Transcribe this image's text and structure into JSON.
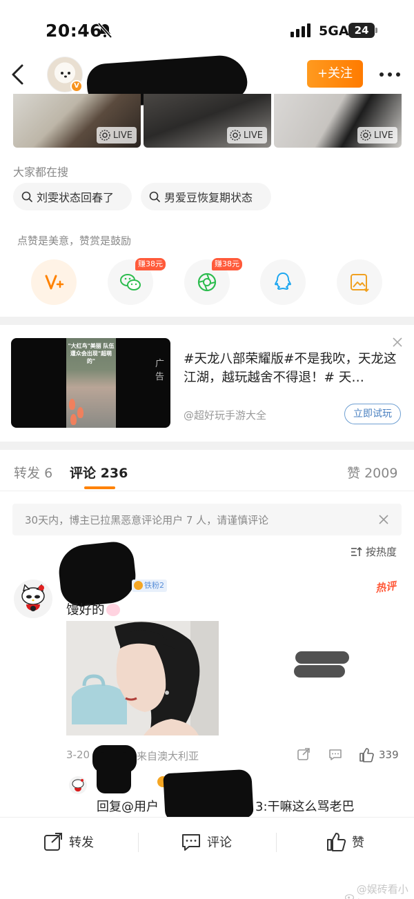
{
  "status_bar": {
    "time": "20:46",
    "network": "5GA",
    "battery": "24"
  },
  "nav": {
    "follow_label": "+关注"
  },
  "photos": {
    "live_label": "LIVE"
  },
  "search": {
    "heading": "大家都在搜",
    "chips": [
      "刘雯状态回春了",
      "男爱豆恢复期状态"
    ]
  },
  "reward": {
    "tip": "点赞是美意，赞赏是鼓励",
    "earn_badge": "赚38元"
  },
  "ad": {
    "label": "广告",
    "title": "#天龙八部荣耀版#不是我吹，天龙这江湖，越玩越舍不得退！# 天…",
    "account": "@超好玩手游大全",
    "cta": "立即试玩",
    "thumb_caption": "\"大红鸟\"美丽 队伍遭众会出现\"超萌的\""
  },
  "tabs": {
    "repost_label": "转发",
    "repost_count": "6",
    "comment_label": "评论",
    "comment_count": "236",
    "like_label": "赞",
    "like_count": "2009"
  },
  "notice": {
    "text": "30天内，博主已拉黑恶意评论用户 7 人，请谨慎评论"
  },
  "sort": {
    "label": "按热度"
  },
  "comment": {
    "fan_badge": "铁粉2",
    "hot_label": "热评",
    "text": "馒好的",
    "date": "3-20",
    "location": "来自澳大利亚",
    "like_count": "339"
  },
  "reply": {
    "prefix": "回复@用户",
    "suffix": "3:干嘛这么骂老巴"
  },
  "action_bar": {
    "repost": "转发",
    "comment": "评论",
    "like": "赞"
  },
  "watermark": {
    "text": "@娱砖看小娱"
  }
}
